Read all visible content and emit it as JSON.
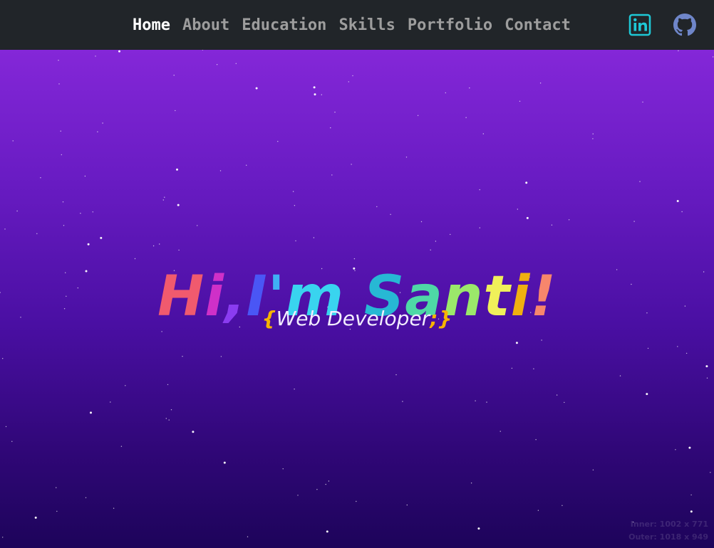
{
  "nav": {
    "items": [
      {
        "label": "Home",
        "active": true
      },
      {
        "label": "About",
        "active": false
      },
      {
        "label": "Education",
        "active": false
      },
      {
        "label": "Skills",
        "active": false
      },
      {
        "label": "Portfolio",
        "active": false
      },
      {
        "label": "Contact",
        "active": false
      }
    ],
    "social": [
      {
        "icon": "linkedin-icon",
        "color": "#1ec8d6"
      },
      {
        "icon": "github-icon",
        "color": "#6f86c9"
      }
    ]
  },
  "hero": {
    "headline_chars": [
      {
        "ch": "H",
        "color": "#f05a6e"
      },
      {
        "ch": "i",
        "color": "#cf30c8"
      },
      {
        "ch": ",",
        "color": "#8a3cf0"
      },
      {
        "ch": "I",
        "color": "#4a56f5"
      },
      {
        "ch": "'",
        "color": "#3fb0f4"
      },
      {
        "ch": "m",
        "color": "#39d4ef"
      },
      {
        "ch": " ",
        "color": "#ffffff"
      },
      {
        "ch": "S",
        "color": "#27b8d4"
      },
      {
        "ch": "a",
        "color": "#4ed8a6"
      },
      {
        "ch": "n",
        "color": "#9be86a"
      },
      {
        "ch": "t",
        "color": "#f0f05a"
      },
      {
        "ch": "i",
        "color": "#f0b010"
      },
      {
        "ch": "!",
        "color": "#f7866c"
      }
    ],
    "subtitle": {
      "open_brace": "{",
      "text": "Web Developer",
      "semicolon": ";",
      "close_brace": "}"
    }
  },
  "size_note": {
    "inner": "Inner: 1002 x 771",
    "outer": "Outer: 1018 x 949"
  },
  "colors": {
    "navbar_bg": "#212529",
    "nav_active": "#ffffff",
    "nav_inactive": "#9d9d9d",
    "brace": "#f7b400",
    "gradient_top": "#8427d8",
    "gradient_bottom": "#1d045a"
  }
}
